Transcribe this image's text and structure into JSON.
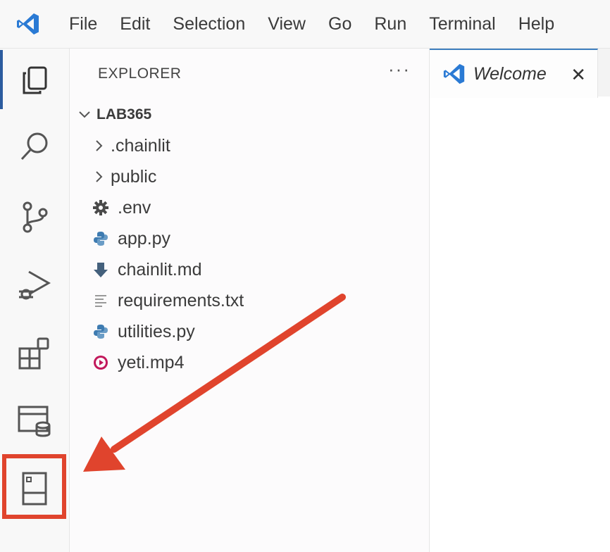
{
  "menubar": {
    "logo": "vscode-logo",
    "items": [
      "File",
      "Edit",
      "Selection",
      "View",
      "Go",
      "Run",
      "Terminal",
      "Help"
    ]
  },
  "activity_bar": {
    "icons": [
      "explorer-icon",
      "search-icon",
      "source-control-icon",
      "run-debug-icon",
      "extensions-icon",
      "database-icon",
      "notebook-panel-icon"
    ],
    "active": "explorer-icon",
    "highlighted": "notebook-panel-icon"
  },
  "sidebar": {
    "title": "EXPLORER",
    "more": "···",
    "root": "LAB365",
    "items": [
      {
        "label": ".chainlit",
        "type": "folder",
        "icon": "chevron-right-icon"
      },
      {
        "label": "public",
        "type": "folder",
        "icon": "chevron-right-icon"
      },
      {
        "label": ".env",
        "type": "file",
        "icon": "gear-file-icon"
      },
      {
        "label": "app.py",
        "type": "file",
        "icon": "python-file-icon"
      },
      {
        "label": "chainlit.md",
        "type": "file",
        "icon": "markdown-file-icon"
      },
      {
        "label": "requirements.txt",
        "type": "file",
        "icon": "text-file-icon"
      },
      {
        "label": "utilities.py",
        "type": "file",
        "icon": "python-file-icon"
      },
      {
        "label": "yeti.mp4",
        "type": "file",
        "icon": "video-file-icon"
      }
    ]
  },
  "editor": {
    "tab_label": "Welcome",
    "tab_close": "✕"
  },
  "colors": {
    "accent": "#2c5c9f",
    "annotation": "#e0442d",
    "python": "#3e7bb1",
    "video": "#c2185b"
  }
}
